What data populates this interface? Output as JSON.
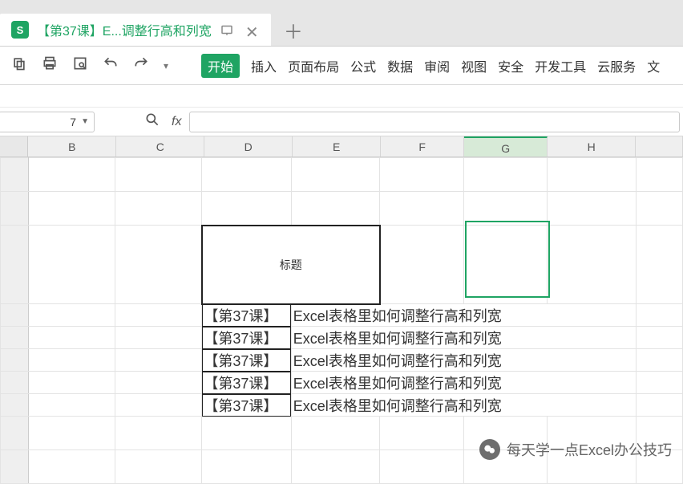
{
  "tab": {
    "icon_letter": "S",
    "title": "【第37课】E...调整行高和列宽"
  },
  "menu": {
    "start": "开始",
    "items": [
      "插入",
      "页面布局",
      "公式",
      "数据",
      "审阅",
      "视图",
      "安全",
      "开发工具",
      "云服务",
      "文"
    ]
  },
  "namebox": {
    "value": "7"
  },
  "formula_bar": {
    "fx_label": "fx",
    "value": ""
  },
  "columns": [
    "B",
    "C",
    "D",
    "E",
    "F",
    "G",
    "H"
  ],
  "selected_column": "G",
  "sheet": {
    "title_cell": "标题",
    "lesson_label": "【第37课】",
    "desc_label": "Excel表格里如何调整行高和列宽",
    "row_count": 5
  },
  "watermark": {
    "text": "每天学一点Excel办公技巧"
  }
}
